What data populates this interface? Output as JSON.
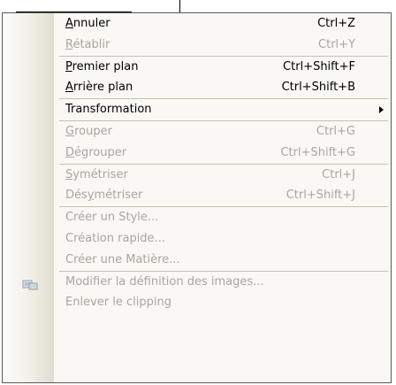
{
  "menu": {
    "items": [
      {
        "label_prefix": "",
        "label_mnemonic": "A",
        "label_rest": "nnuler",
        "shortcut": "Ctrl+Z",
        "enabled": true
      },
      {
        "label_prefix": "",
        "label_mnemonic": "R",
        "label_rest": "établir",
        "shortcut": "Ctrl+Y",
        "enabled": false
      },
      {
        "label_prefix": "",
        "label_mnemonic": "P",
        "label_rest": "remier plan",
        "shortcut": "Ctrl+Shift+F",
        "enabled": true
      },
      {
        "label_prefix": "",
        "label_mnemonic": "A",
        "label_rest": "rrière plan",
        "shortcut": "Ctrl+Shift+B",
        "enabled": true
      },
      {
        "label": "Transformation",
        "enabled": true,
        "submenu": true
      },
      {
        "label_prefix": "",
        "label_mnemonic": "G",
        "label_rest": "rouper",
        "shortcut": "Ctrl+G",
        "enabled": false
      },
      {
        "label_prefix": "",
        "label_mnemonic": "D",
        "label_rest": "égrouper",
        "shortcut": "Ctrl+Shift+G",
        "enabled": false
      },
      {
        "label_prefix": "",
        "label_mnemonic": "S",
        "label_rest": "ymétriser",
        "shortcut": "Ctrl+J",
        "enabled": false
      },
      {
        "label_prefix": "Dés",
        "label_mnemonic": "y",
        "label_rest": "métriser",
        "shortcut": "Ctrl+Shift+J",
        "enabled": false
      },
      {
        "label": "Créer un Style...",
        "enabled": false
      },
      {
        "label": "Création rapide...",
        "enabled": false
      },
      {
        "label": "Créer une Matière...",
        "enabled": false
      },
      {
        "label": "Modifier la définition des images...",
        "enabled": false,
        "icon": "image-edit-icon"
      },
      {
        "label": "Enlever le clipping",
        "enabled": false
      }
    ]
  }
}
